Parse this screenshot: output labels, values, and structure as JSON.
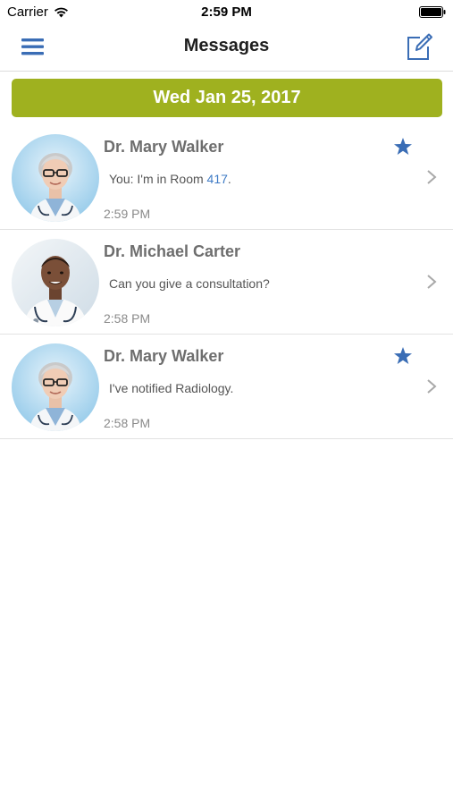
{
  "status_bar": {
    "carrier": "Carrier",
    "time": "2:59 PM"
  },
  "nav": {
    "title": "Messages",
    "menu_icon": "hamburger-menu-icon",
    "compose_icon": "compose-icon"
  },
  "date_header": "Wed Jan 25, 2017",
  "colors": {
    "accent": "#9fb11f",
    "icon_blue": "#3a6db5",
    "link_blue": "#3f7bc5"
  },
  "messages": [
    {
      "sender": "Dr. Mary Walker",
      "preview_prefix": "You: I'm in Room ",
      "preview_highlight": "417",
      "preview_suffix": ".",
      "time": "2:59 PM",
      "starred": true
    },
    {
      "sender": "Dr. Michael Carter",
      "preview_prefix": "Can you give a consultation?",
      "preview_highlight": "",
      "preview_suffix": "",
      "time": "2:58 PM",
      "starred": false
    },
    {
      "sender": "Dr. Mary Walker",
      "preview_prefix": "I've notified Radiology.",
      "preview_highlight": "",
      "preview_suffix": "",
      "time": "2:58 PM",
      "starred": true
    }
  ]
}
